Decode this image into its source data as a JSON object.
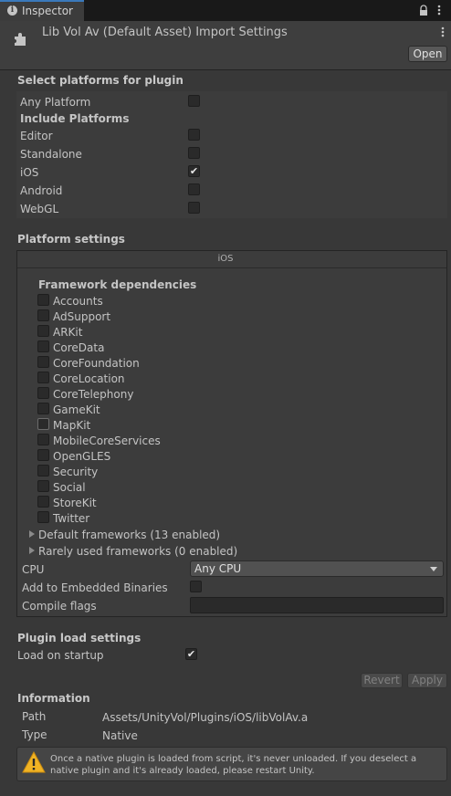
{
  "tab": {
    "label": "Inspector"
  },
  "header": {
    "title": "Lib Vol Av (Default Asset) Import Settings",
    "open_button": "Open"
  },
  "select_platforms": {
    "title": "Select platforms for plugin",
    "any_platform": {
      "label": "Any Platform",
      "checked": false
    },
    "include_title": "Include Platforms",
    "platforms": [
      {
        "label": "Editor",
        "checked": false
      },
      {
        "label": "Standalone",
        "checked": false
      },
      {
        "label": "iOS",
        "checked": true
      },
      {
        "label": "Android",
        "checked": false
      },
      {
        "label": "WebGL",
        "checked": false
      }
    ]
  },
  "platform_settings": {
    "title": "Platform settings",
    "tab_label": "iOS",
    "framework_title": "Framework dependencies",
    "frameworks": [
      "Accounts",
      "AdSupport",
      "ARKit",
      "CoreData",
      "CoreFoundation",
      "CoreLocation",
      "CoreTelephony",
      "GameKit",
      "MapKit",
      "MobileCoreServices",
      "OpenGLES",
      "Security",
      "Social",
      "StoreKit",
      "Twitter"
    ],
    "default_frameworks": "Default frameworks (13 enabled)",
    "rarely_used": "Rarely used frameworks (0 enabled)",
    "cpu_label": "CPU",
    "cpu_value": "Any CPU",
    "embedded_label": "Add to Embedded Binaries",
    "compile_label": "Compile flags",
    "compile_value": ""
  },
  "plugin_load": {
    "title": "Plugin load settings",
    "load_on_startup": "Load on startup",
    "load_checked": true
  },
  "actions": {
    "revert": "Revert",
    "apply": "Apply"
  },
  "information": {
    "title": "Information",
    "path_label": "Path",
    "path_value": "Assets/UnityVol/Plugins/iOS/libVolAv.a",
    "type_label": "Type",
    "type_value": "Native",
    "warning": "Once a native plugin is loaded from script, it's never unloaded. If you deselect a native plugin and it's already loaded, please restart Unity."
  }
}
